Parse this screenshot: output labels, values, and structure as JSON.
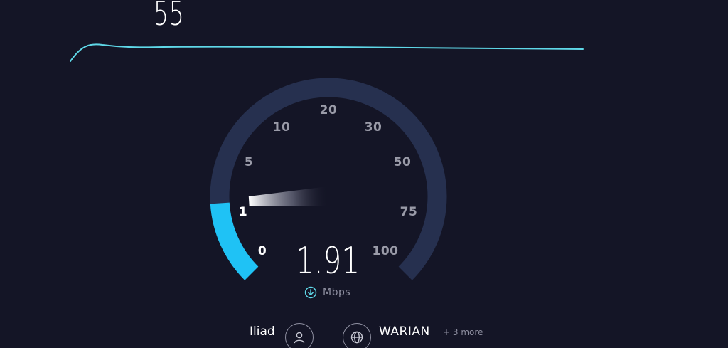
{
  "ping": {
    "value": "55"
  },
  "trend_line": {
    "color": "#5fd8e8"
  },
  "gauge": {
    "track_color": "#26304f",
    "active_color": "#1fc2f5",
    "background": "#141526",
    "scale_labels": [
      "0",
      "1",
      "5",
      "10",
      "20",
      "30",
      "50",
      "75",
      "100"
    ],
    "active_labels": [
      "0",
      "1"
    ],
    "current_speed": 1.91
  },
  "speed": {
    "value": "1.91",
    "unit": "Mbps",
    "direction_icon": "download-arrow-icon"
  },
  "server_info": {
    "isp_name": "Iliad",
    "isp_icon": "user-icon",
    "server_icon": "globe-icon",
    "server_name": "WARIAN",
    "more_servers": "+ 3 more"
  }
}
